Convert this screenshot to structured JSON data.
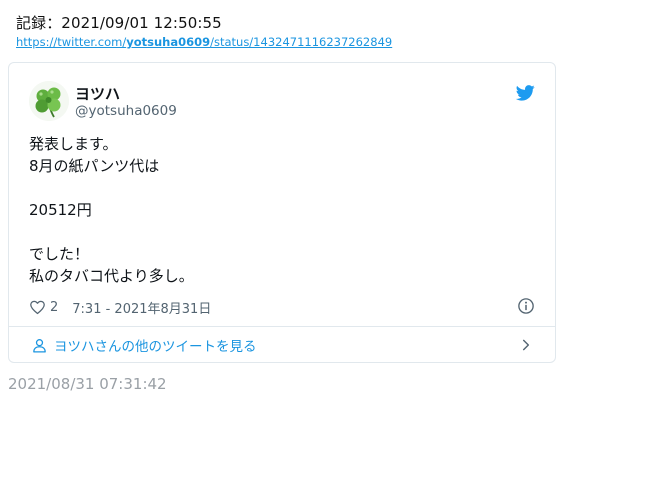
{
  "record": {
    "text": "記録：2021/09/01 12:50:55"
  },
  "archive_link": {
    "prefix": "https://twitter.com/",
    "user": "yotsuha0609",
    "suffix": "/status/1432471116237262849"
  },
  "tweet": {
    "display_name": "ヨツハ",
    "handle": "@yotsuha0609",
    "lines": [
      "発表します。",
      "8月の紙パンツ代は",
      "",
      "20512円",
      "",
      "でした！",
      "私のタバコ代より多し。"
    ],
    "like_count": "2",
    "timestamp": "7:31 - 2021年8月31日",
    "more_link": "ヨツハさんの他のツイートを見る",
    "icons": {
      "avatar": "clover-avatar",
      "brand": "twitter-bird-icon",
      "like": "heart-icon",
      "info": "info-icon",
      "profile": "person-icon",
      "more": "chevron-right-icon"
    },
    "colors": {
      "accent": "#1b95e0",
      "meta": "#536471",
      "border": "#e1e8ed"
    }
  },
  "saved_date": "2021/08/31 07:31:42"
}
